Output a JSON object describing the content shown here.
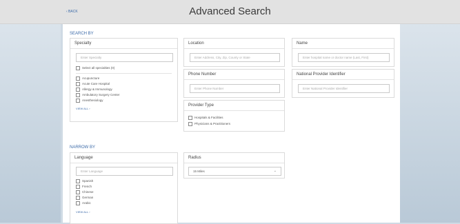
{
  "header": {
    "back_label": "‹ BACK",
    "title": "Advanced Search"
  },
  "search_by": {
    "heading": "SEARCH BY",
    "specialty": {
      "title": "Specialty",
      "placeholder": "Enter Specialty",
      "select_all": "Select all specialties (0)",
      "options": [
        "Acupuncture",
        "Acute Care Hospital",
        "Allergy & Immunology",
        "Ambulatory Surgery Center",
        "Anesthesiology"
      ],
      "view_all": "VIEW ALL ›"
    },
    "location": {
      "title": "Location",
      "placeholder": "Enter Address, City, Zip, County or State"
    },
    "name": {
      "title": "Name",
      "placeholder": "Enter hospital name or doctor name (Last, First)"
    },
    "phone": {
      "title": "Phone Number",
      "placeholder": "Enter Phone Number"
    },
    "npi": {
      "title": "National Provider Identifier",
      "placeholder": "Enter National Provider Identifier"
    },
    "provider_type": {
      "title": "Provider Type",
      "options": [
        "Hospitals & Facilities",
        "Physicians & Practitioners"
      ]
    }
  },
  "narrow_by": {
    "heading": "NARROW BY",
    "language": {
      "title": "Language",
      "placeholder": "Enter Language",
      "options": [
        "Spanish",
        "French",
        "Chinese",
        "German",
        "Arabic"
      ],
      "view_all": "VIEW ALL ›"
    },
    "radius": {
      "title": "Radius",
      "value": "15 Miles"
    }
  }
}
